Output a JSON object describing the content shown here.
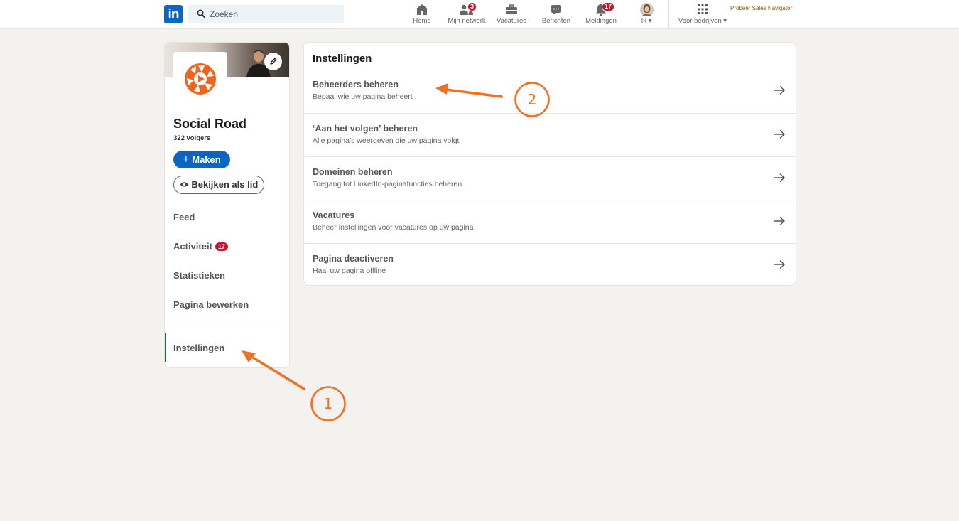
{
  "nav": {
    "logo_text": "in",
    "search_placeholder": "Zoeken",
    "items": [
      {
        "label": "Home",
        "icon": "home-icon"
      },
      {
        "label": "Mijn netwerk",
        "icon": "network-icon",
        "badge": "3"
      },
      {
        "label": "Vacatures",
        "icon": "briefcase-icon"
      },
      {
        "label": "Berichten",
        "icon": "messaging-icon"
      },
      {
        "label": "Meldingen",
        "icon": "bell-icon",
        "badge": "17"
      },
      {
        "label": "Ik",
        "icon": "avatar"
      },
      {
        "label": "Voor bedrijven",
        "icon": "grid-icon"
      }
    ],
    "promo": "Probeer Sales Navigator"
  },
  "org": {
    "name": "Social Road",
    "followers": "322 volgers",
    "create_button": "Maken",
    "view_as_member_button": "Bekijken als lid",
    "menu": [
      {
        "label": "Feed"
      },
      {
        "label": "Activiteit",
        "badge": "17"
      },
      {
        "label": "Statistieken"
      },
      {
        "label": "Pagina bewerken"
      },
      {
        "label": "Instellingen",
        "active": true
      }
    ]
  },
  "settings": {
    "title": "Instellingen",
    "rows": [
      {
        "title": "Beheerders beheren",
        "description": "Bepaal wie uw pagina beheert"
      },
      {
        "title": "‘Aan het volgen’ beheren",
        "description": "Alle pagina’s weergeven die uw pagina volgt"
      },
      {
        "title": "Domeinen beheren",
        "description": "Toegang tot LinkedIn-paginafuncties beheren"
      },
      {
        "title": "Vacatures",
        "description": "Beheer instellingen voor vacatures op uw pagina"
      },
      {
        "title": "Pagina deactiveren",
        "description": "Haal uw pagina offline"
      }
    ]
  },
  "annotations": [
    {
      "number": "1"
    },
    {
      "number": "2"
    }
  ],
  "colors": {
    "brand": "#0a66c2",
    "badge": "#cb112d",
    "annotation": "#f26f21",
    "active_indicator": "#057642"
  }
}
